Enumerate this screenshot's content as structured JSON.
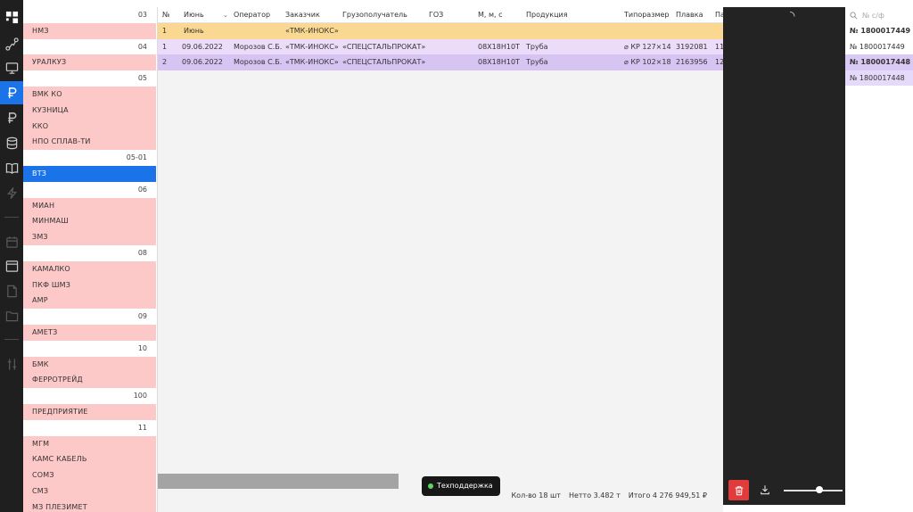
{
  "rail": {
    "icons": [
      "logo-icon",
      "route-icon",
      "monitor-icon",
      "ruble-icon",
      "ruble-icon",
      "database-icon",
      "book-icon",
      "lightning-icon",
      "calendar-icon",
      "window-icon",
      "document-icon",
      "folder-icon",
      "sliders-icon"
    ]
  },
  "groups": [
    {
      "head": "03",
      "items": [
        "НМЗ"
      ]
    },
    {
      "head": "04",
      "items": [
        "УРАЛКУЗ"
      ]
    },
    {
      "head": "05",
      "items": [
        "ВМК КО",
        "КУЗНИЦА",
        "ККО",
        "НПО СПЛАВ-ТИ"
      ]
    },
    {
      "head": "05-01",
      "items": [
        "ВТЗ"
      ]
    },
    {
      "head": "06",
      "items": [
        "МИАН",
        "МИНМАШ",
        "ЗМЗ"
      ]
    },
    {
      "head": "08",
      "items": [
        "КАМАЛКО",
        "ПКФ ШМЗ",
        "АМР"
      ]
    },
    {
      "head": "09",
      "items": [
        "АМЕТЗ"
      ]
    },
    {
      "head": "10",
      "items": [
        "БМК",
        "ФЕРРОТРЕЙД"
      ]
    },
    {
      "head": "100",
      "items": [
        "ПРЕДПРИЯТИЕ"
      ]
    },
    {
      "head": "11",
      "items": [
        "МГМ",
        "КАМС КАБЕЛЬ",
        "СОМЗ",
        "СМЗ",
        "МЗ ПЛЕЗИМЕТ"
      ]
    }
  ],
  "selected_group": "ВТЗ",
  "table": {
    "headers": [
      "№",
      "Июнь",
      "Оператор",
      "Заказчик",
      "Грузополучатель",
      "ГОЗ",
      "М, м, с",
      "Продукция",
      "Типоразмер",
      "Плавка",
      "Па"
    ],
    "group_row": {
      "num": "1",
      "month": "Июнь",
      "customer": "«ТМК-ИНОКС»"
    },
    "rows": [
      {
        "num": "1",
        "date": "09.06.2022",
        "operator": "Морозов С.Б.",
        "customer": "«ТМК-ИНОКС»",
        "consignee": "«СПЕЦСТАЛЬПРОКАТ»",
        "grade": "08Х18Н10Т",
        "product": "Труба",
        "size": "⌀ КР 127×14",
        "melt": "3192081",
        "extra": "11"
      },
      {
        "num": "2",
        "date": "09.06.2022",
        "operator": "Морозов С.Б.",
        "customer": "«ТМК-ИНОКС»",
        "consignee": "«СПЕЦСТАЛЬПРОКАТ»",
        "grade": "08Х18Н10Т",
        "product": "Труба",
        "size": "⌀ КР 102×18",
        "melt": "2163956",
        "extra": "12"
      }
    ]
  },
  "support": {
    "label": "Техподдержка"
  },
  "totals": {
    "count": "Кол-во 18 шт",
    "netto": "Нетто 3.482 т",
    "total": "Итого 4 276 949,51 ₽"
  },
  "viewer": {
    "zoom_level": 0.6
  },
  "invoices": {
    "search_placeholder": "№ с/ф",
    "items": [
      "№ 1800017449",
      "№ 1800017449",
      "№ 1800017448",
      "№ 1800017448"
    ]
  },
  "colors": {
    "accent": "#1a73e8",
    "group_row": "#fbd891",
    "row_light": "#ecdcfa",
    "row_dark": "#d7c4f3",
    "group_item": "#fdc8c8",
    "delete": "#e23b3b"
  }
}
